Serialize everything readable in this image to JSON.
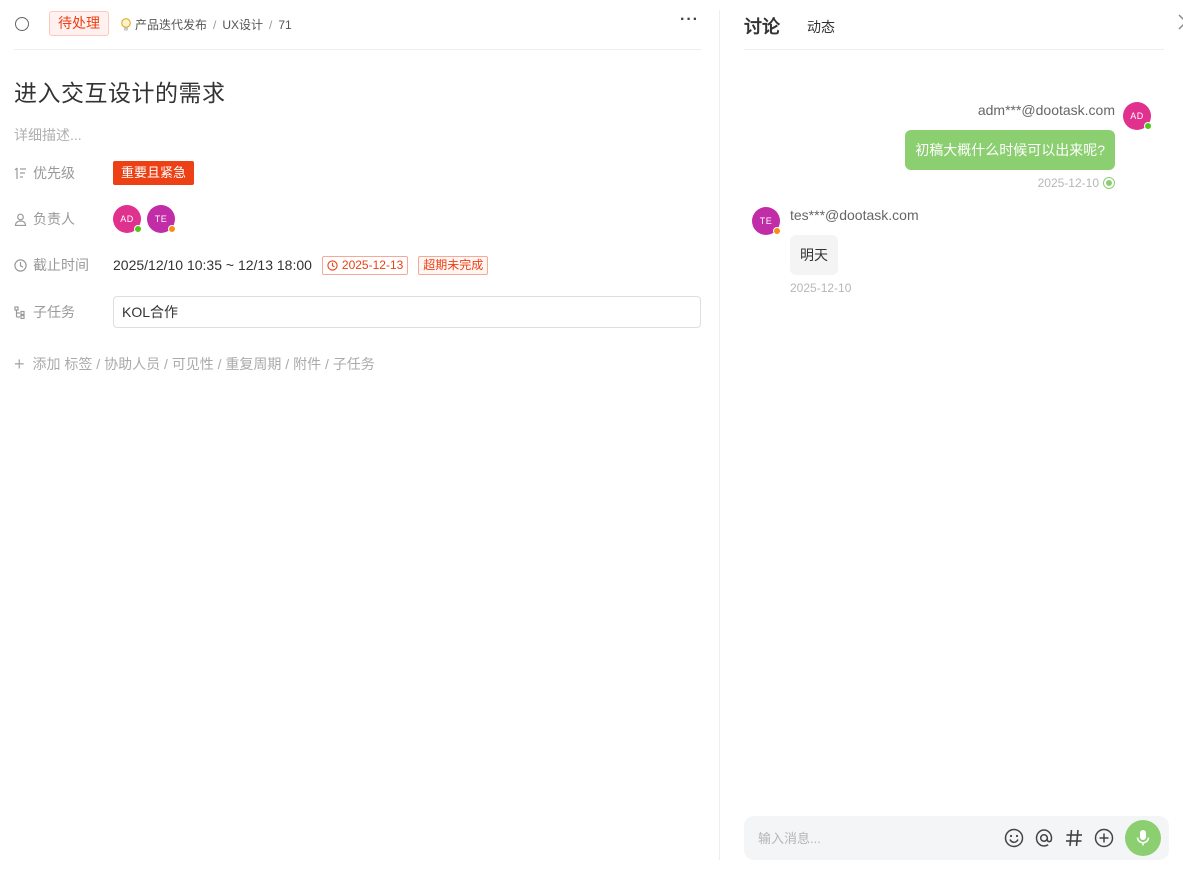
{
  "task": {
    "status": "待处理",
    "breadcrumb": [
      "产品迭代发布",
      "UX设计",
      "71"
    ],
    "more_label": "···",
    "title": "进入交互设计的需求",
    "description_placeholder": "详细描述..."
  },
  "fields": {
    "priority": {
      "label": "优先级",
      "value": "重要且紧急",
      "color": "#ed4014"
    },
    "owners": {
      "label": "负责人",
      "avatars": [
        {
          "initials": "AD",
          "color": "#e0318f",
          "status_color": "#52c41a"
        },
        {
          "initials": "TE",
          "color": "#c12ca7",
          "status_color": "#fa8c16"
        }
      ]
    },
    "deadline": {
      "label": "截止时间",
      "range": "2025/12/10 10:35 ~ 12/13 18:00",
      "date_tag": "2025-12-13",
      "overdue": "超期未完成"
    },
    "subtask": {
      "label": "子任务",
      "value": "KOL合作"
    },
    "add_more": "添加 标签 / 协助人员 / 可见性 / 重复周期 / 附件 / 子任务"
  },
  "panel": {
    "tabs": [
      "讨论",
      "动态"
    ],
    "messages": [
      {
        "sender": "adm***@dootask.com",
        "initials": "AD",
        "avatar_color": "#e0318f",
        "status_color": "#52c41a",
        "text": "初稿大概什么时候可以出来呢?",
        "time": "2025-12-10",
        "self": true
      },
      {
        "sender": "tes***@dootask.com",
        "initials": "TE",
        "avatar_color": "#c12ca7",
        "status_color": "#fa8c16",
        "text": "明天",
        "time": "2025-12-10",
        "self": false
      }
    ],
    "input_placeholder": "输入消息..."
  },
  "colors": {
    "accent_green": "#8bcf70",
    "danger": "#ed4014"
  }
}
